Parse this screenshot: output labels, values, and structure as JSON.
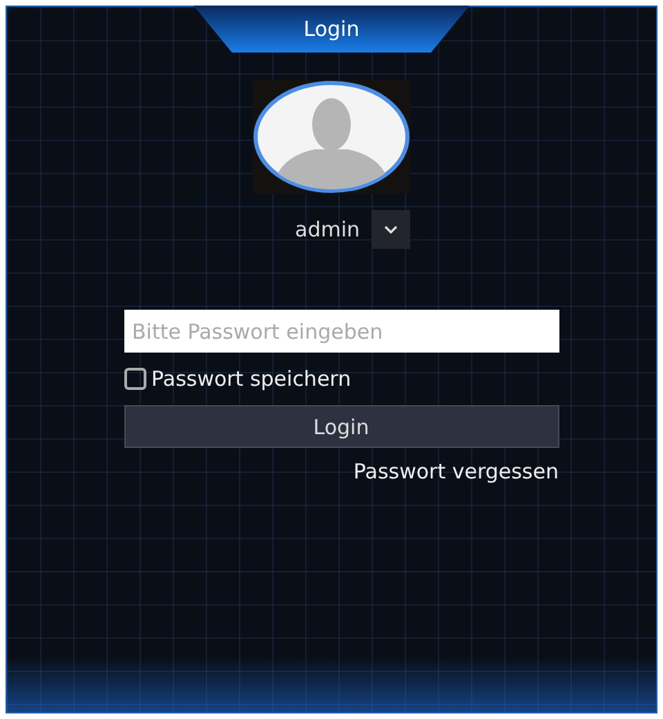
{
  "window": {
    "title": "Login"
  },
  "user": {
    "name": "admin"
  },
  "password": {
    "placeholder": "Bitte Passwort eingeben"
  },
  "remember": {
    "label": "Passwort speichern",
    "checked": false
  },
  "login_button": "Login",
  "forgot_link": "Passwort vergessen"
}
